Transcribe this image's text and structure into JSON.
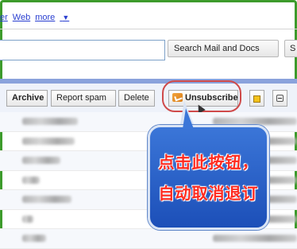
{
  "topnav": {
    "partial_link": "er",
    "web": "Web",
    "more": "more",
    "more_arrow": "▼"
  },
  "search": {
    "query": "",
    "search_button": "Search Mail and Docs",
    "s_button": "S"
  },
  "toolbar": {
    "archive": "Archive",
    "report_spam": "Report spam",
    "delete": "Delete",
    "unsubscribe": "Unsubscribe",
    "unsubscribe_icon": "unsubscribe-icon",
    "plus_icon": "star-icon",
    "minus_icon": "minus-icon"
  },
  "mail_rows": [
    {
      "sender_blurred": true,
      "subject_blurred": true
    },
    {
      "sender_blurred": true,
      "subject_blurred": true
    },
    {
      "sender_blurred": true,
      "subject_blurred": true
    },
    {
      "sender_blurred": true,
      "subject_blurred": true
    },
    {
      "sender_blurred": true,
      "subject_blurred": true
    },
    {
      "sender_blurred": true,
      "subject_blurred": true
    },
    {
      "sender_blurred": true,
      "subject_blurred": true
    }
  ],
  "callout": {
    "line1": "点击此按钮，",
    "line2": "自动取消退订"
  },
  "colors": {
    "frame": "#3d9b2c",
    "highlight_ring": "#cf4a4a",
    "callout_bg": "#2a62c8",
    "callout_text": "#ff2a1f",
    "toolbar_band": "#8aa2dc"
  }
}
